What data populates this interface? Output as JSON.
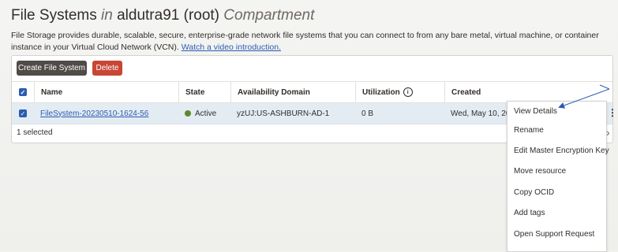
{
  "header": {
    "title_main": "File Systems",
    "title_in": "in",
    "title_compartment": "aldutra91 (root)",
    "title_suffix": "Compartment"
  },
  "description": {
    "text": "File Storage provides durable, scalable, secure, enterprise-grade network file systems that you can connect to from any bare metal, virtual machine, or container instance in your Virtual Cloud Network (VCN).",
    "link": "Watch a video introduction."
  },
  "toolbar": {
    "create_label": "Create File System",
    "delete_label": "Delete"
  },
  "table": {
    "columns": [
      "Name",
      "State",
      "Availability Domain",
      "Utilization",
      "Created"
    ],
    "rows": [
      {
        "name": "FileSystem-20230510-1624-56",
        "state": "Active",
        "availability_domain": "yzUJ:US-ASHBURN-AD-1",
        "utilization": "0 B",
        "created": "Wed, May 10, 2023"
      }
    ],
    "selected_text": "1 selected"
  },
  "menu": {
    "items": [
      "View Details",
      "Rename",
      "Edit Master Encryption Key",
      "Move resource",
      "Copy OCID",
      "Add tags",
      "Open Support Request"
    ]
  },
  "colors": {
    "accent": "#2c5cb1",
    "delete": "#c74634",
    "active": "#5f8a2a"
  },
  "icons": {
    "info": "info-icon",
    "kebab": "kebab-icon",
    "chevron": "chevron-right-icon"
  }
}
